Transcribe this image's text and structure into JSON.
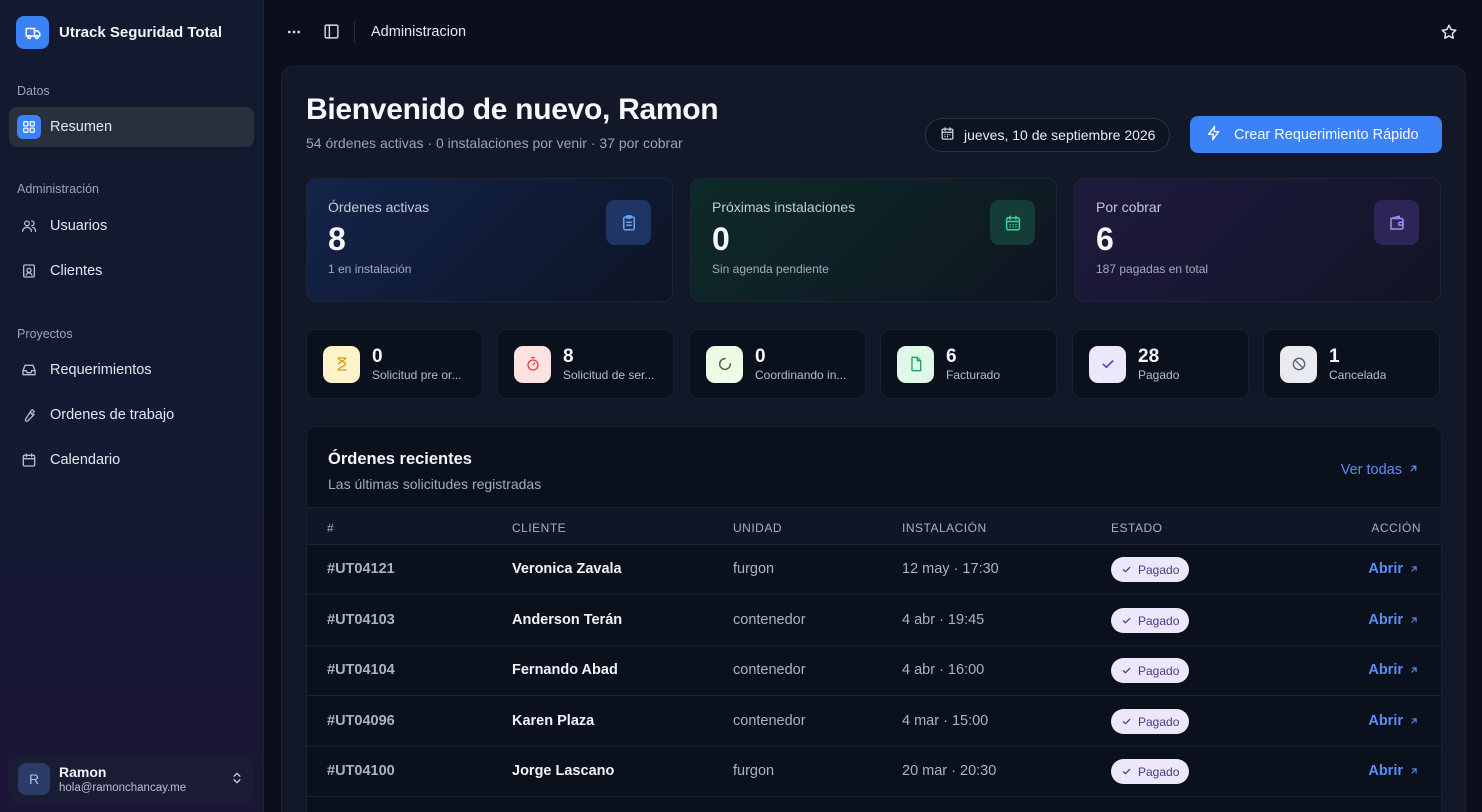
{
  "sidebar": {
    "brand": "Utrack Seguridad Total",
    "groups": [
      {
        "label": "Datos"
      },
      {
        "label": "Administración"
      },
      {
        "label": "Proyectos"
      }
    ],
    "items": [
      {
        "label": "Resumen",
        "icon": "dashboard-icon",
        "active": true
      },
      {
        "label": "Usuarios",
        "icon": "users-icon"
      },
      {
        "label": "Clientes",
        "icon": "id-badge-icon"
      },
      {
        "label": "Requerimientos",
        "icon": "inbox-icon"
      },
      {
        "label": "Ordenes de trabajo",
        "icon": "wrench-icon"
      },
      {
        "label": "Calendario",
        "icon": "calendar-icon"
      }
    ],
    "user": {
      "initial": "R",
      "name": "Ramon",
      "email": "hola@ramonchancay.me"
    }
  },
  "header": {
    "title": "Administracion"
  },
  "main": {
    "welcome": "Bienvenido de nuevo, Ramon",
    "subline": "54 órdenes activas · 0 instalaciones por venir · 37 por cobrar",
    "date": "jueves, 10 de septiembre 2026",
    "cta": "Crear Requerimiento Rápido",
    "stats": [
      {
        "label": "Órdenes activas",
        "value": "8",
        "sub": "1 en instalación",
        "icon": "clipboard-icon",
        "color": "#60a5fa"
      },
      {
        "label": "Próximas instalaciones",
        "value": "0",
        "sub": "Sin agenda pendiente",
        "icon": "calendar-icon",
        "color": "#34d399"
      },
      {
        "label": "Por cobrar",
        "value": "6",
        "sub": "187 pagadas en total",
        "icon": "wallet-icon",
        "color": "#a78bfa"
      }
    ],
    "statuses": [
      {
        "value": "0",
        "label": "Solicitud pre or...",
        "icon": "hourglass-icon"
      },
      {
        "value": "8",
        "label": "Solicitud de ser...",
        "icon": "timer-icon"
      },
      {
        "value": "0",
        "label": "Coordinando in...",
        "icon": "loader-icon"
      },
      {
        "value": "6",
        "label": "Facturado",
        "icon": "document-icon"
      },
      {
        "value": "28",
        "label": "Pagado",
        "icon": "check-icon"
      },
      {
        "value": "1",
        "label": "Cancelada",
        "icon": "ban-icon"
      }
    ]
  },
  "orders": {
    "title": "Órdenes recientes",
    "subtitle": "Las últimas solicitudes registradas",
    "view_all": "Ver todas",
    "columns": [
      "#",
      "CLIENTE",
      "UNIDAD",
      "INSTALACIÓN",
      "ESTADO",
      "ACCIÓN"
    ],
    "rows": [
      {
        "id": "#UT04121",
        "client": "Veronica Zavala",
        "unit": "furgon",
        "install": "12 may · 17:30",
        "status": "Pagado",
        "action": "Abrir"
      },
      {
        "id": "#UT04103",
        "client": "Anderson Terán",
        "unit": "contenedor",
        "install": "4 abr · 19:45",
        "status": "Pagado",
        "action": "Abrir"
      },
      {
        "id": "#UT04104",
        "client": "Fernando Abad",
        "unit": "contenedor",
        "install": "4 abr · 16:00",
        "status": "Pagado",
        "action": "Abrir"
      },
      {
        "id": "#UT04096",
        "client": "Karen Plaza",
        "unit": "contenedor",
        "install": "4 mar · 15:00",
        "status": "Pagado",
        "action": "Abrir"
      },
      {
        "id": "#UT04100",
        "client": "Jorge Lascano",
        "unit": "furgon",
        "install": "20 mar · 20:30",
        "status": "Pagado",
        "action": "Abrir"
      }
    ]
  },
  "colors": {
    "accent": "#3b82f6",
    "link": "#5b8ef5",
    "badge_bg": "#ece7fb"
  }
}
